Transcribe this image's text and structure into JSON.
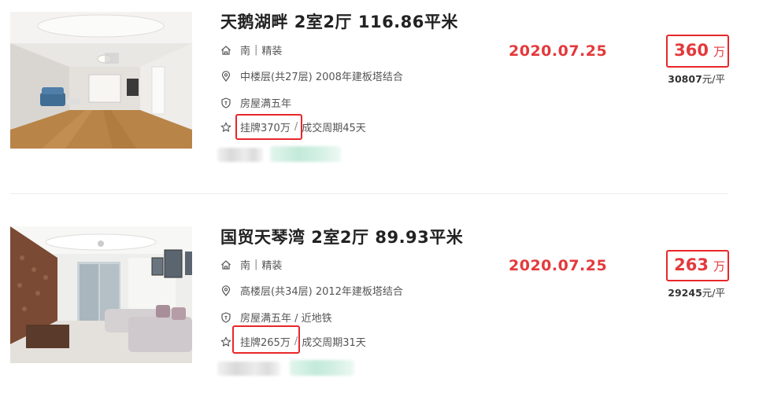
{
  "listings": [
    {
      "title": "天鹅湖畔 2室2厅 116.86平米",
      "orientation": "南",
      "decoration": "精装",
      "floor_info": "中楼层(共27层) 2008年建板塔结合",
      "tags": "房屋满五年",
      "listing_price": "挂牌370万",
      "deal_cycle": "成交周期45天",
      "deal_date": "2020.07.25",
      "total_price": "360",
      "total_unit": "万",
      "unit_price": "30807",
      "unit_price_suffix": "元/平"
    },
    {
      "title": "国贸天琴湾 2室2厅 89.93平米",
      "orientation": "南",
      "decoration": "精装",
      "floor_info": "高楼层(共34层) 2012年建板塔结合",
      "tags": "房屋满五年 / 近地铁",
      "listing_price": "挂牌265万",
      "deal_cycle": "成交周期31天",
      "deal_date": "2020.07.25",
      "total_price": "263",
      "total_unit": "万",
      "unit_price": "29245",
      "unit_price_suffix": "元/平"
    }
  ],
  "icons": {
    "house": "house-icon",
    "location": "location-pin-icon",
    "shield": "shield-icon",
    "star": "star-icon"
  },
  "colors": {
    "accent_red": "#e4393c",
    "highlight_box": "#e8272a",
    "title": "#222222"
  }
}
